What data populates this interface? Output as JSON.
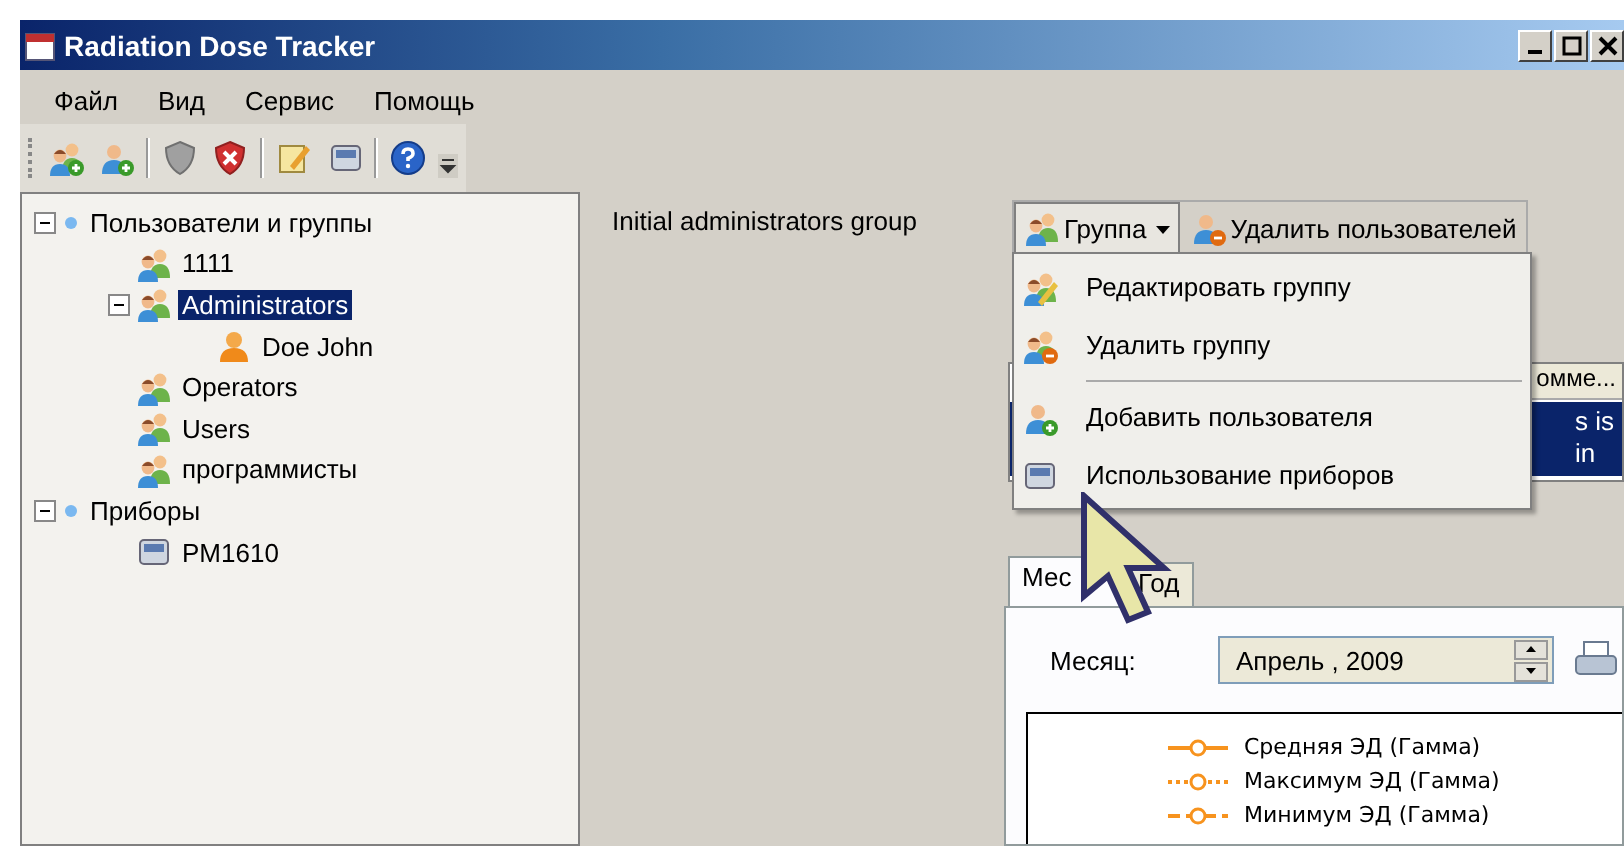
{
  "window": {
    "title": "Radiation Dose Tracker"
  },
  "menu_bar": [
    "Файл",
    "Вид",
    "Сервис",
    "Помощь"
  ],
  "toolbar": [
    {
      "kind": "group-add"
    },
    {
      "kind": "user-add"
    },
    {
      "kind": "sep"
    },
    {
      "kind": "shield"
    },
    {
      "kind": "shield-x"
    },
    {
      "kind": "sep"
    },
    {
      "kind": "edit"
    },
    {
      "kind": "device"
    },
    {
      "kind": "sep"
    },
    {
      "kind": "help"
    },
    {
      "kind": "overflow"
    }
  ],
  "tree": [
    {
      "label": "Пользователи и группы",
      "kind": "root",
      "expanded": true,
      "selected": false,
      "children": [
        {
          "label": "1111",
          "kind": "group",
          "selected": false
        },
        {
          "label": "Administrators",
          "kind": "group",
          "expanded": true,
          "selected": true,
          "children": [
            {
              "label": "Doe John",
              "kind": "user",
              "selected": false
            }
          ]
        },
        {
          "label": "Operators",
          "kind": "group",
          "selected": false
        },
        {
          "label": "Users",
          "kind": "group",
          "selected": false
        },
        {
          "label": "программисты",
          "kind": "group",
          "selected": false
        }
      ]
    },
    {
      "label": "Приборы",
      "kind": "root",
      "expanded": true,
      "selected": false,
      "children": [
        {
          "label": "PM1610",
          "kind": "device",
          "selected": false
        }
      ]
    }
  ],
  "detail": {
    "description": "Initial administrators group",
    "actions": [
      {
        "label": "Группа",
        "kind": "group-menu",
        "pressed": true
      },
      {
        "label": "Удалить пользователей",
        "kind": "remove-users",
        "pressed": false
      }
    ],
    "group_menu": [
      {
        "label": "Редактировать группу",
        "kind": "edit-group"
      },
      {
        "label": "Удалить группу",
        "kind": "delete-group"
      },
      {
        "kind": "separator"
      },
      {
        "label": "Добавить пользователя",
        "kind": "add-user"
      },
      {
        "label": "Использование приборов",
        "kind": "device"
      }
    ],
    "list": {
      "column_header": "омме...",
      "row_lines": [
        "s is",
        "in"
      ],
      "row_selected": true
    },
    "tabs": [
      {
        "label": "Мес",
        "selected": true
      },
      {
        "label": "Год",
        "selected": false
      }
    ],
    "month_label": "Месяц:",
    "month_value": "Апрель  , 2009",
    "legend": [
      {
        "label": "Средняя ЭД (Гамма)",
        "kind": "solid"
      },
      {
        "label": "Максимум ЭД (Гамма)",
        "kind": "dotted"
      },
      {
        "label": "Минимум ЭД (Гамма)",
        "kind": "dashed"
      }
    ]
  }
}
